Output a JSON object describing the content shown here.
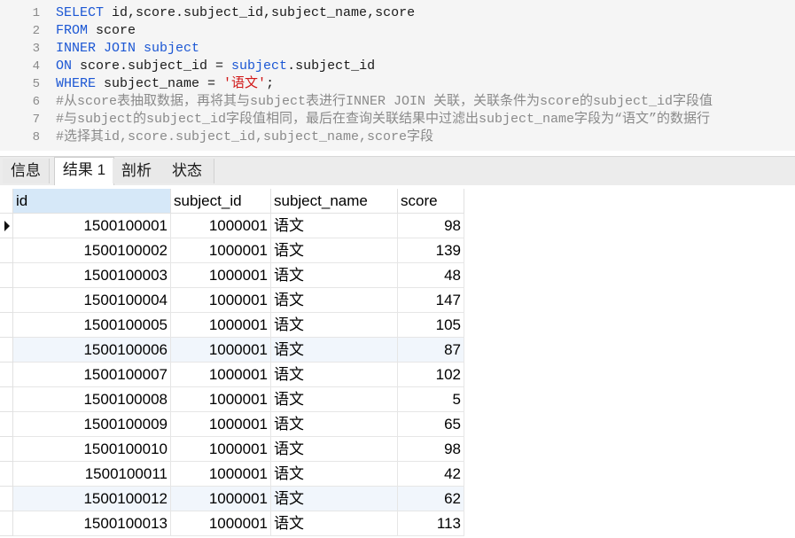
{
  "editor": {
    "lines": [
      {
        "n": "1",
        "parts": [
          {
            "t": "SELECT ",
            "c": "kw"
          },
          {
            "t": "id,score.subject_id,subject_name,score",
            "c": "tx"
          }
        ]
      },
      {
        "n": "2",
        "parts": [
          {
            "t": "FROM ",
            "c": "kw"
          },
          {
            "t": "score",
            "c": "tx"
          }
        ]
      },
      {
        "n": "3",
        "parts": [
          {
            "t": "INNER JOIN ",
            "c": "kw"
          },
          {
            "t": "subject",
            "c": "kw"
          }
        ]
      },
      {
        "n": "4",
        "parts": [
          {
            "t": "ON ",
            "c": "kw"
          },
          {
            "t": "score.subject_id = ",
            "c": "tx"
          },
          {
            "t": "subject",
            "c": "kw"
          },
          {
            "t": ".subject_id",
            "c": "tx"
          }
        ]
      },
      {
        "n": "5",
        "parts": [
          {
            "t": "WHERE ",
            "c": "kw"
          },
          {
            "t": "subject_name = ",
            "c": "tx"
          },
          {
            "t": "'语文'",
            "c": "str"
          },
          {
            "t": ";",
            "c": "tx"
          }
        ]
      },
      {
        "n": "6",
        "parts": [
          {
            "t": "#从score表抽取数据，再将其与subject表进行INNER JOIN 关联，关联条件为score的subject_id字段值",
            "c": "cm"
          }
        ]
      },
      {
        "n": "7",
        "parts": [
          {
            "t": "#与subject的subject_id字段值相同，最后在查询关联结果中过滤出subject_name字段为“语文”的数据行",
            "c": "cm"
          }
        ]
      },
      {
        "n": "8",
        "parts": [
          {
            "t": "#选择其id,score.subject_id,subject_name,score字段",
            "c": "cm"
          }
        ]
      }
    ]
  },
  "tabs": [
    {
      "label": "信息",
      "active": false
    },
    {
      "label": "结果 1",
      "active": true
    },
    {
      "label": "剖析",
      "active": false
    },
    {
      "label": "状态",
      "active": false
    }
  ],
  "grid": {
    "columns": [
      "id",
      "subject_id",
      "subject_name",
      "score"
    ],
    "rows": [
      [
        "1500100001",
        "1000001",
        "语文",
        "98"
      ],
      [
        "1500100002",
        "1000001",
        "语文",
        "139"
      ],
      [
        "1500100003",
        "1000001",
        "语文",
        "48"
      ],
      [
        "1500100004",
        "1000001",
        "语文",
        "147"
      ],
      [
        "1500100005",
        "1000001",
        "语文",
        "105"
      ],
      [
        "1500100006",
        "1000001",
        "语文",
        "87"
      ],
      [
        "1500100007",
        "1000001",
        "语文",
        "102"
      ],
      [
        "1500100008",
        "1000001",
        "语文",
        "5"
      ],
      [
        "1500100009",
        "1000001",
        "语文",
        "65"
      ],
      [
        "1500100010",
        "1000001",
        "语文",
        "98"
      ],
      [
        "1500100011",
        "1000001",
        "语文",
        "42"
      ],
      [
        "1500100012",
        "1000001",
        "语文",
        "62"
      ],
      [
        "1500100013",
        "1000001",
        "语文",
        "113"
      ]
    ]
  },
  "colors": {
    "keyword": "#1c57d4",
    "string": "#d11818",
    "comment": "#8a8a8a",
    "header_selected": "#d6e8f8",
    "row_alt": "#f1f6fc"
  }
}
